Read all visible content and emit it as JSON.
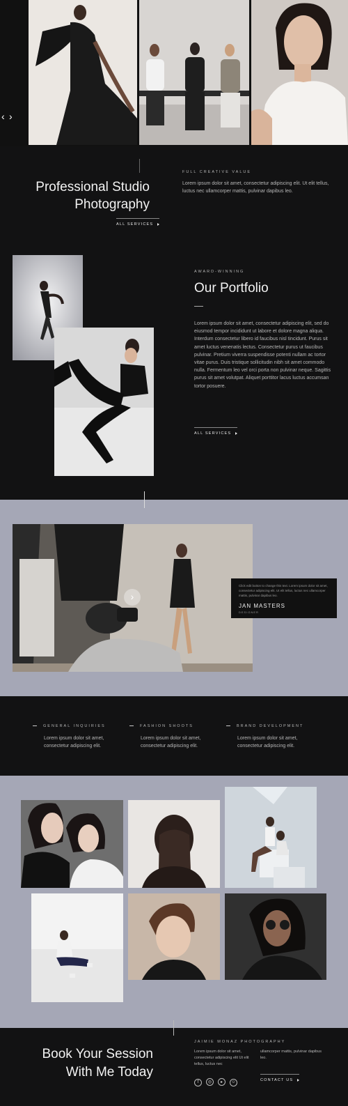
{
  "hero": {
    "prev_arrow": "‹",
    "next_arrow": "›"
  },
  "intro": {
    "title_line1": "Professional Studio",
    "title_line2": "Photography",
    "services_link": "ALL SERVICES",
    "kicker": "FULL CREATIVE VALUE",
    "text": "Lorem ipsum dolor sit amet, consectetur adipiscing elit. Ut elit tellus, luctus nec ullamcorper mattis, pulvinar dapibus leo."
  },
  "portfolio": {
    "kicker": "AWARD-WINNING",
    "title": "Our Portfolio",
    "text": "Lorem ipsum dolor sit amet, consectetur adipiscing elit, sed do eiusmod tempor incididunt ut labore et dolore magna aliqua. Interdum consectetur libero id faucibus nisl tincidunt. Purus sit amet luctus venenatis lectus. Consectetur purus ut faucibus pulvinar. Pretium viverra suspendisse potenti nullam ac tortor vitae purus. Duis tristique sollicitudin nibh sit amet commodo nulla. Fermentum leo vel orci porta non pulvinar neque. Sagittis purus sit amet volutpat. Aliquet porttitor lacus luctus accumsan tortor posuere.",
    "services_link": "ALL SERVICES"
  },
  "feature": {
    "card_text": "Click edit button to change this text. Lorem ipsum dolor sit amet, consectetur adipiscing elit. Ut elit tellus, luctus nec ullamcorper mattis, pulvinar dapibus leo.",
    "name": "JAN MASTERS",
    "role": "DESIGNER",
    "play_icon": "›"
  },
  "services": [
    {
      "title": "GENERAL INQUIRIES",
      "text": "Lorem ipsum dolor sit amet, consectetur adipiscing elit."
    },
    {
      "title": "FASHION SHOOTS",
      "text": "Lorem ipsum dolor sit amet, consectetur adipiscing elit."
    },
    {
      "title": "BRAND DEVELOPMENT",
      "text": "Lorem ipsum dolor sit amet, consectetur adipiscing elit."
    }
  ],
  "footer": {
    "title_line1": "Book Your Session",
    "title_line2": "With Me Today",
    "brand": "JAIMIE MONAZ PHOTOGRAPHY",
    "col1": "Lorem ipsum dolor sit amet, consectetur adipiscing elit Ut elit tellus, luctus nec",
    "col2": "ullamcorper mattis, pulvinar dapibus leo.",
    "contact_link": "CONTACT US",
    "social_icons": [
      "facebook-icon",
      "instagram-icon",
      "youtube-icon",
      "snapchat-icon"
    ]
  },
  "colors": {
    "background": "#121213",
    "band": "#a5a7b6",
    "text": "#e6e6e6"
  }
}
